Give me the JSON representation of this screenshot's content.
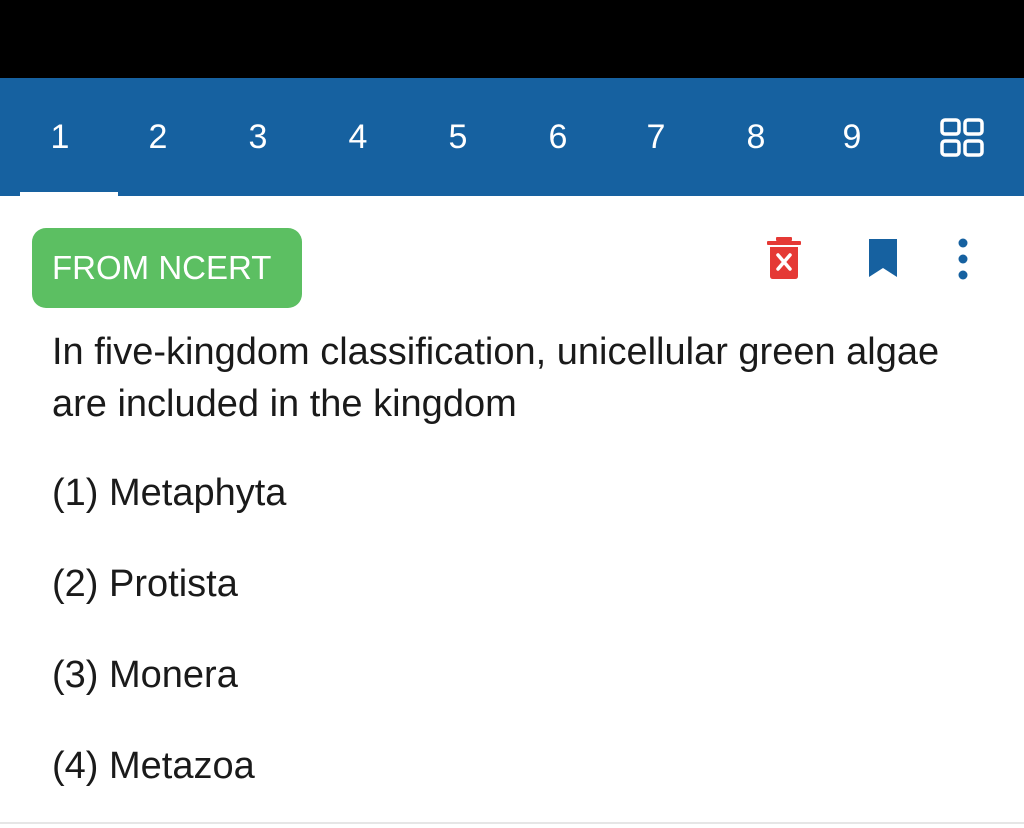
{
  "nav": {
    "tabs": [
      "1",
      "2",
      "3",
      "4",
      "5",
      "6",
      "7",
      "8",
      "9"
    ],
    "active_tab": "1",
    "grid_icon": "grid-view-icon"
  },
  "badge": {
    "label": "FROM NCERT"
  },
  "actions": {
    "delete_icon": "delete-icon",
    "bookmark_icon": "bookmark-icon",
    "more_icon": "more-vertical-icon"
  },
  "question": {
    "text": "In five-kingdom classification, unicellular green algae are included in the kingdom"
  },
  "options": [
    "(1) Metaphyta",
    "(2) Protista",
    "(3) Monera",
    "(4) Metazoa"
  ],
  "colors": {
    "nav_background": "#1661a0",
    "badge_background": "#5cbf62",
    "delete_icon": "#e53935",
    "bookmark_icon": "#1661a0",
    "more_icon": "#1661a0"
  }
}
